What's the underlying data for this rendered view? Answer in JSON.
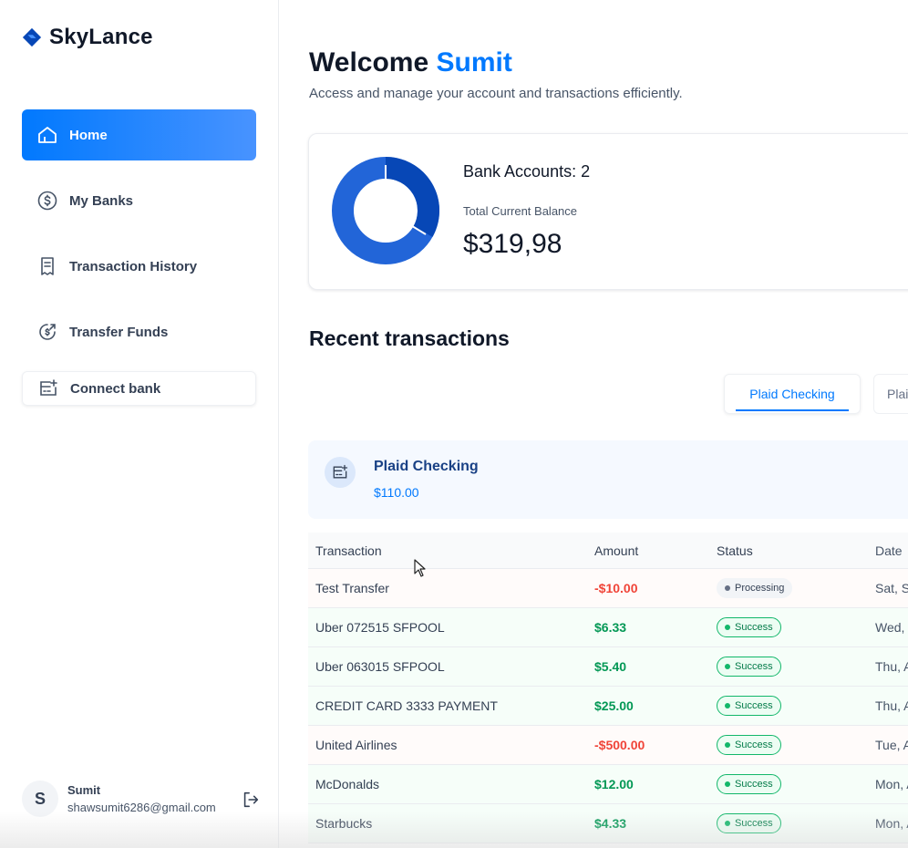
{
  "app": {
    "name": "SkyLance",
    "brand_color": "#0179fe"
  },
  "sidebar": {
    "items": [
      {
        "label": "Home",
        "icon": "home-icon",
        "active": true
      },
      {
        "label": "My Banks",
        "icon": "dollar-circle-icon",
        "active": false
      },
      {
        "label": "Transaction History",
        "icon": "receipt-icon",
        "active": false
      },
      {
        "label": "Transfer Funds",
        "icon": "money-send-icon",
        "active": false
      },
      {
        "label": "Connect bank",
        "icon": "connect-bank-icon",
        "active": false
      }
    ]
  },
  "user": {
    "initial": "S",
    "name": "Sumit",
    "email": "shawsumit6286@gmail.com"
  },
  "header": {
    "welcome_prefix": "Welcome",
    "welcome_name": "Sumit",
    "subtitle": "Access and manage your account and transactions efficiently."
  },
  "balance": {
    "bank_accounts_label": "Bank Accounts: 2",
    "total_label": "Total Current Balance",
    "total_value": "$319,98",
    "donut_colors": [
      "#0747b6",
      "#2265d8"
    ]
  },
  "recent": {
    "title": "Recent transactions",
    "tabs": [
      "Plaid Checking",
      "Plai"
    ],
    "active_tab": 0
  },
  "account": {
    "name": "Plaid Checking",
    "balance": "$110.00"
  },
  "table": {
    "headers": [
      "Transaction",
      "Amount",
      "Status",
      "Date"
    ],
    "rows": [
      {
        "name": "Test Transfer",
        "amount": "-$10.00",
        "status": "Processing",
        "date": "Sat, Se",
        "type": "debit"
      },
      {
        "name": "Uber 072515 SFPOOL",
        "amount": "$6.33",
        "status": "Success",
        "date": "Wed, J",
        "type": "credit"
      },
      {
        "name": "Uber 063015 SFPOOL",
        "amount": "$5.40",
        "status": "Success",
        "date": "Thu, A",
        "type": "credit"
      },
      {
        "name": "CREDIT CARD 3333 PAYMENT",
        "amount": "$25.00",
        "status": "Success",
        "date": "Thu, A",
        "type": "credit"
      },
      {
        "name": "United Airlines",
        "amount": "-$500.00",
        "status": "Success",
        "date": "Tue, A",
        "type": "debit"
      },
      {
        "name": "McDonalds",
        "amount": "$12.00",
        "status": "Success",
        "date": "Mon, A",
        "type": "credit"
      },
      {
        "name": "Starbucks",
        "amount": "$4.33",
        "status": "Success",
        "date": "Mon, A",
        "type": "credit"
      }
    ]
  }
}
